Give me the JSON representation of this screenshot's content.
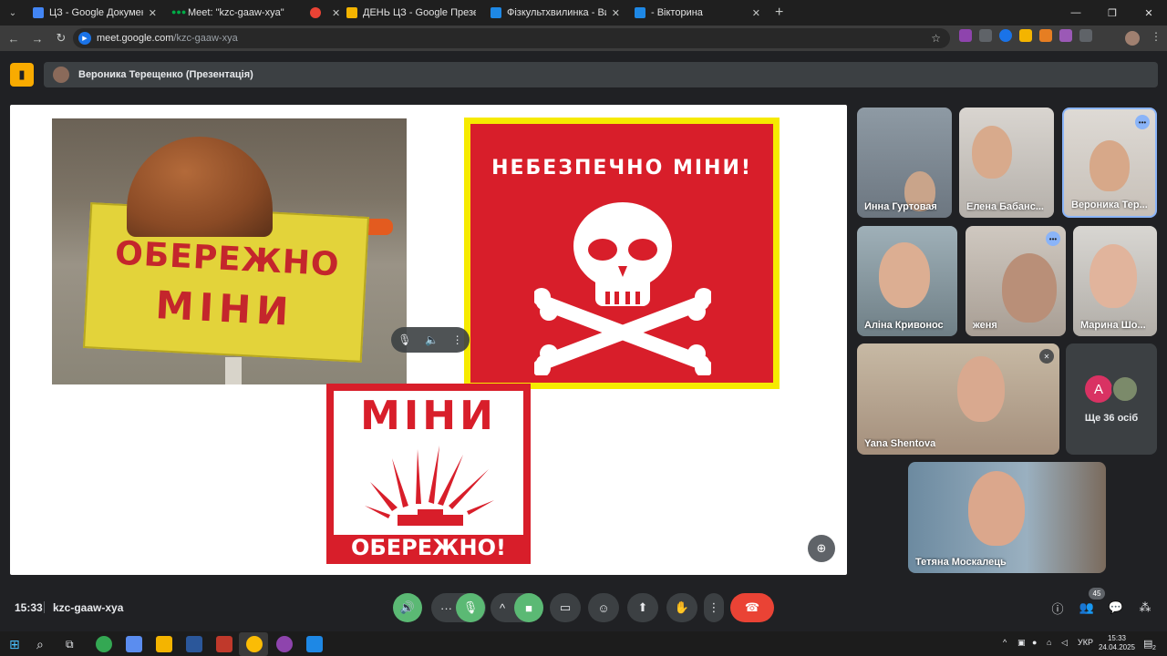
{
  "browser": {
    "tabs": [
      {
        "title": "ЦЗ - Google Документи",
        "color": "#4285f4"
      },
      {
        "title": "Meet: \"kzc-gaaw-xya\"",
        "color": "#00ac47"
      },
      {
        "title": "",
        "color": "#ea4335"
      },
      {
        "title": "ДЕНЬ ЦЗ - Google Презентації",
        "color": "#f4b400"
      },
      {
        "title": "Фізкультхвилинка - Випадкове",
        "color": "#1e88e5"
      },
      {
        "title": "- Вікторина",
        "color": "#1e88e5"
      }
    ],
    "new_tab": "+",
    "url_host": "meet.google.com",
    "url_path": "/kzc-gaaw-xya"
  },
  "meet": {
    "presenter_banner": "Вероника Терещенко (Презентація)",
    "slide": {
      "photo_sign_line1": "ОБЕРЕЖНО",
      "photo_sign_line2": "МІНИ",
      "red_sign_text": "НЕБЕЗПЕЧНО МІНИ!",
      "mine_sign_title": "МІНИ",
      "mine_sign_bottom": "ОБЕРЕЖНО!"
    },
    "participants": [
      {
        "name": "Инна Гуртовая"
      },
      {
        "name": "Елена Бабанс..."
      },
      {
        "name": "Вероника Тер..."
      },
      {
        "name": "Аліна Кривонос"
      },
      {
        "name": "женя"
      },
      {
        "name": "Марина Шо..."
      },
      {
        "name": "Yana Shentova"
      },
      {
        "name": "Тетяна Москалець"
      }
    ],
    "more_people": "Ще 36 осіб",
    "more_avatar_letter": "A",
    "time": "15:33",
    "code": "kzc-gaaw-xya",
    "participant_count": "45"
  },
  "taskbar": {
    "language": "УКР",
    "time": "15:33",
    "date": "24.04.2025",
    "notifications": "2"
  }
}
